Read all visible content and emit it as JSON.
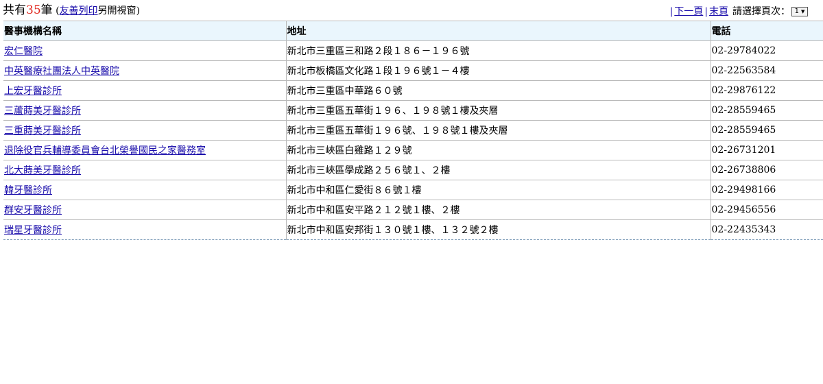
{
  "summary": {
    "prefix": "共有",
    "count": "35",
    "unit": "筆",
    "open_paren": " (",
    "print_link": "友善列印",
    "new_window": "另開視窗",
    "close_paren": ")"
  },
  "pager": {
    "next_label": "下一頁",
    "last_label": "末頁",
    "select_label": "請選擇頁次：",
    "selected_page": "1"
  },
  "table": {
    "headers": [
      "醫事機構名稱",
      "地址",
      "電話"
    ],
    "rows": [
      {
        "name": "宏仁醫院",
        "address": "新北市三重區三和路２段１８６－１９６號",
        "phone": "02-29784022"
      },
      {
        "name": "中英醫療社團法人中英醫院",
        "address": "新北市板橋區文化路１段１９６號１－４樓",
        "phone": "02-22563584"
      },
      {
        "name": "上宏牙醫診所",
        "address": "新北市三重區中華路６０號",
        "phone": "02-29876122"
      },
      {
        "name": "三蘆蒔美牙醫診所",
        "address": "新北市三重區五華街１９６、１９８號１樓及夾層",
        "phone": "02-28559465"
      },
      {
        "name": "三重蒔美牙醫診所",
        "address": "新北市三重區五華街１９６號、１９８號１樓及夾層",
        "phone": "02-28559465"
      },
      {
        "name": "退除役官兵輔導委員會台北榮譽國民之家醫務室",
        "address": "新北市三峽區白雞路１２９號",
        "phone": "02-26731201"
      },
      {
        "name": "北大蒔美牙醫診所",
        "address": "新北市三峽區學成路２５６號１、２樓",
        "phone": "02-26738806"
      },
      {
        "name": "韓牙醫診所",
        "address": "新北市中和區仁愛街８６號１樓",
        "phone": "02-29498166"
      },
      {
        "name": "群安牙醫診所",
        "address": "新北市中和區安平路２１２號１樓、２樓",
        "phone": "02-29456556"
      },
      {
        "name": "瑞星牙醫診所",
        "address": "新北市中和區安邦街１３０號１樓、１３２號２樓",
        "phone": "02-22435343"
      }
    ]
  }
}
